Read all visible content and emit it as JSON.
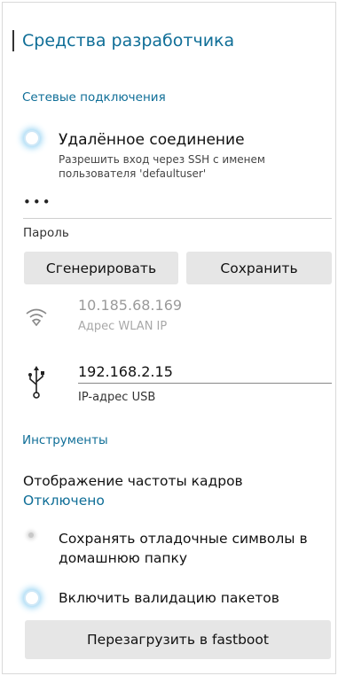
{
  "header": {
    "title": "Средства разработчика"
  },
  "network": {
    "section_title": "Сетевые подключения",
    "remote": {
      "title": "Удалённое соединение",
      "description": "Разрешить вход через SSH с именем пользователя 'defaultuser'",
      "enabled": true
    },
    "password": {
      "value": "•••",
      "label": "Пароль"
    },
    "buttons": {
      "generate": "Сгенерировать",
      "save": "Сохранить"
    },
    "wlan": {
      "ip": "10.185.68.169",
      "label": "Адрес WLAN IP",
      "icon": "wifi-icon"
    },
    "usb": {
      "ip": "192.168.2.15",
      "label": "IP-адрес USB",
      "icon": "usb-icon"
    }
  },
  "tools": {
    "section_title": "Инструменты",
    "fps": {
      "title": "Отображение частоты кадров",
      "value": "Отключено"
    },
    "debug_symbols": {
      "label": "Сохранять отладочные символы в домашнюю папку",
      "enabled": false
    },
    "package_validation": {
      "label": "Включить валидацию пакетов",
      "enabled": true
    },
    "fastboot_button": "Перезагрузить в fastboot"
  },
  "colors": {
    "accent": "#0f6e97",
    "button_bg": "#e6e6e6",
    "muted": "#9a9a9a"
  }
}
